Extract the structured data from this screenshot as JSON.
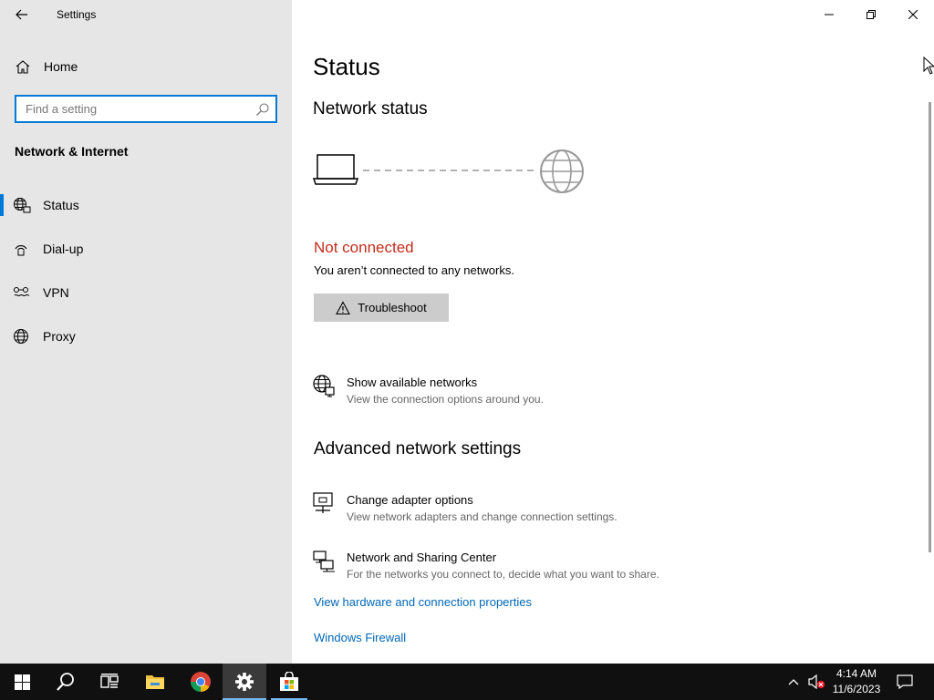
{
  "window": {
    "app_title": "Settings",
    "controls": {
      "minimize": "minimize-icon",
      "restore": "restore-icon",
      "close": "close-icon"
    }
  },
  "sidebar": {
    "home_label": "Home",
    "search_placeholder": "Find a setting",
    "search_value": "",
    "section_title": "Network & Internet",
    "items": [
      {
        "label": "Status",
        "icon": "globe-network-icon",
        "selected": true
      },
      {
        "label": "Dial-up",
        "icon": "dialup-icon",
        "selected": false
      },
      {
        "label": "VPN",
        "icon": "vpn-icon",
        "selected": false
      },
      {
        "label": "Proxy",
        "icon": "globe-icon",
        "selected": false
      }
    ]
  },
  "main": {
    "page_title": "Status",
    "network_status_title": "Network status",
    "status_text": "Not connected",
    "status_description": "You aren’t connected to any networks.",
    "troubleshoot_label": "Troubleshoot",
    "show_networks": {
      "label": "Show available networks",
      "description": "View the connection options around you."
    },
    "advanced_title": "Advanced network settings",
    "adapter_options": {
      "label": "Change adapter options",
      "description": "View network adapters and change connection settings."
    },
    "sharing_center": {
      "label": "Network and Sharing Center",
      "description": "For the networks you connect to, decide what you want to share."
    },
    "hardware_link": "View hardware and connection properties",
    "firewall_link": "Windows Firewall"
  },
  "colors": {
    "accent": "#0078d7",
    "error": "#c42b1c",
    "link": "#0067b8",
    "sidebar_bg": "#e6e6e6",
    "taskbar_bg": "#101010"
  },
  "taskbar": {
    "apps": [
      "start-icon",
      "search-icon",
      "task-view-icon",
      "file-explorer-icon",
      "chrome-icon",
      "settings-icon",
      "store-icon"
    ],
    "active_app": "settings-icon",
    "time": "4:14 AM",
    "date": "11/6/2023"
  }
}
